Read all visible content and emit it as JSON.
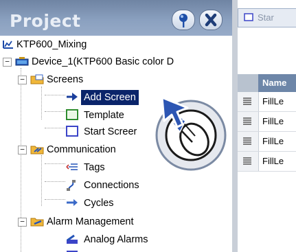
{
  "panel": {
    "title": "Project"
  },
  "tree": {
    "root": "KTP600_Mixing",
    "device": "Device_1(KTP600 Basic color D",
    "screens": "Screens",
    "add_screen": "Add Screen",
    "template": "Template",
    "start_screen": "Start Screer",
    "communication": "Communication",
    "tags": "Tags",
    "connections": "Connections",
    "cycles": "Cycles",
    "alarm_management": "Alarm Management",
    "analog_alarms": "Analog Alarms"
  },
  "workspace": {
    "tab_label": "Star",
    "table": {
      "header_name": "Name",
      "rows": [
        "FillLe",
        "FillLe",
        "FillLe",
        "FillLe"
      ]
    }
  },
  "colors": {
    "header_blue": "#7e93b3",
    "selection": "#0a246a"
  }
}
